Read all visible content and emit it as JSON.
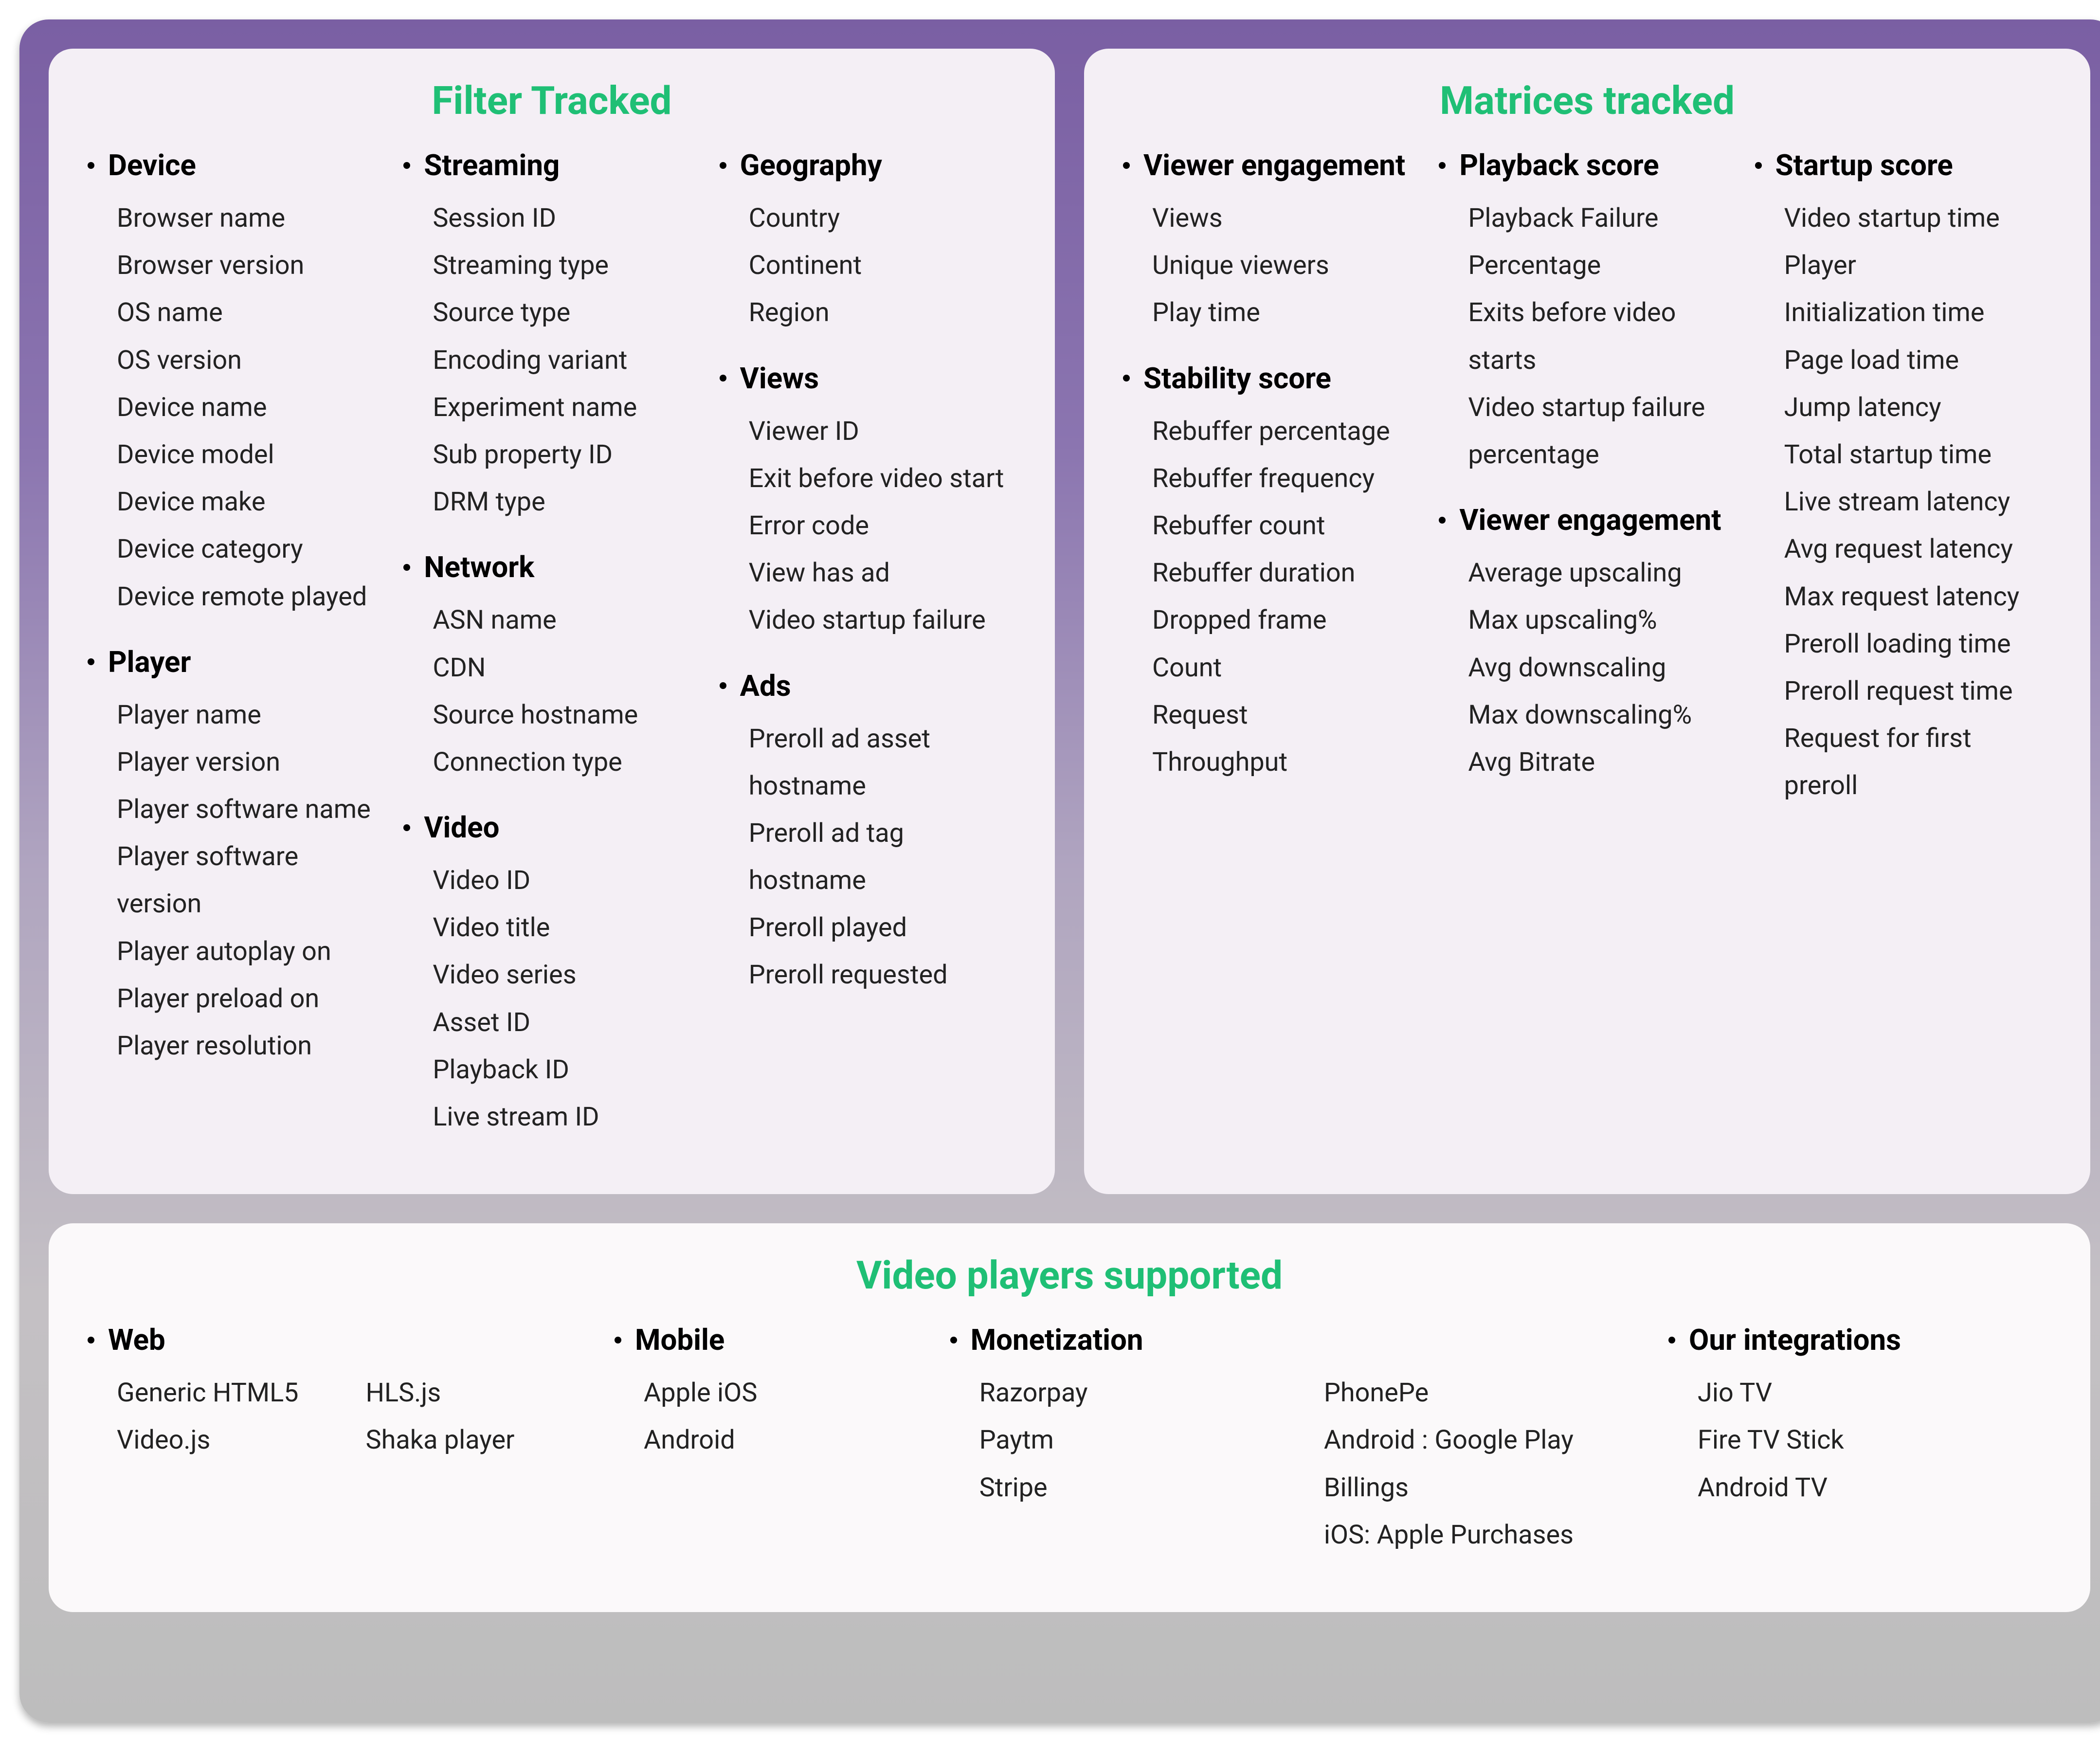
{
  "filter": {
    "title": "Filter Tracked",
    "col1": [
      {
        "header": "Device",
        "items": [
          "Browser name",
          "Browser version",
          "OS name",
          "OS version",
          "Device name",
          "Device model",
          "Device make",
          "Device category",
          "Device remote played"
        ]
      },
      {
        "header": "Player",
        "items": [
          "Player name",
          "Player version",
          "Player software name",
          "Player software version",
          "Player autoplay on",
          "Player preload on",
          "Player resolution"
        ]
      }
    ],
    "col2": [
      {
        "header": "Streaming",
        "items": [
          "Session ID",
          "Streaming type",
          "Source type",
          "Encoding variant",
          "Experiment name",
          "Sub property ID",
          "DRM type"
        ]
      },
      {
        "header": "Network",
        "items": [
          "ASN name",
          "CDN",
          "Source hostname",
          "Connection type"
        ]
      },
      {
        "header": "Video",
        "items": [
          "Video ID",
          "Video title",
          "Video series",
          "Asset ID",
          "Playback ID",
          "Live stream ID"
        ]
      }
    ],
    "col3": [
      {
        "header": "Geography",
        "items": [
          "Country",
          "Continent",
          "Region"
        ]
      },
      {
        "header": "Views",
        "items": [
          "Viewer ID",
          "Exit before video start",
          "Error code",
          "View has ad",
          "Video startup failure"
        ]
      },
      {
        "header": "Ads",
        "items": [
          "Preroll ad asset hostname",
          "Preroll ad tag hostname",
          "Preroll played",
          "Preroll requested"
        ]
      }
    ]
  },
  "matrices": {
    "title": "Matrices tracked",
    "col1": [
      {
        "header": "Viewer engagement",
        "items": [
          "Views",
          "Unique viewers",
          "Play time"
        ]
      },
      {
        "header": "Stability score",
        "items": [
          "Rebuffer percentage",
          "Rebuffer frequency",
          "Rebuffer count",
          "Rebuffer duration",
          "Dropped frame",
          "Count",
          "Request",
          "Throughput"
        ]
      }
    ],
    "col2": [
      {
        "header": "Playback score",
        "items": [
          "Playback Failure",
          "Percentage",
          "Exits before video starts",
          "Video startup failure percentage"
        ]
      },
      {
        "header": "Viewer engagement",
        "items": [
          "Average upscaling",
          "Max upscaling%",
          "Avg downscaling",
          "Max downscaling%",
          "Avg Bitrate"
        ]
      }
    ],
    "col3": [
      {
        "header": "Startup score",
        "items": [
          "Video startup time",
          "Player",
          "Initialization time",
          "Page load time",
          "Jump latency",
          "Total startup time",
          "Live stream latency",
          "Avg request latency",
          "Max request latency",
          "Preroll loading time",
          "Preroll request time",
          "Request for first preroll"
        ]
      }
    ]
  },
  "players": {
    "title": "Video players supported",
    "web": {
      "header": "Web",
      "colA": [
        "Generic HTML5",
        "Video.js"
      ],
      "colB": [
        "HLS.js",
        "Shaka player"
      ]
    },
    "mobile": {
      "header": "Mobile",
      "items": [
        "Apple iOS",
        "Android"
      ]
    },
    "monetization": {
      "header": "Monetization",
      "colA": [
        "Razorpay",
        "Paytm",
        "Stripe"
      ],
      "colB": [
        "PhonePe",
        "Android : Google Play Billings",
        "iOS: Apple Purchases"
      ]
    },
    "integrations": {
      "header": "Our integrations",
      "items": [
        "Jio TV",
        "Fire TV Stick",
        "Android TV"
      ]
    }
  }
}
